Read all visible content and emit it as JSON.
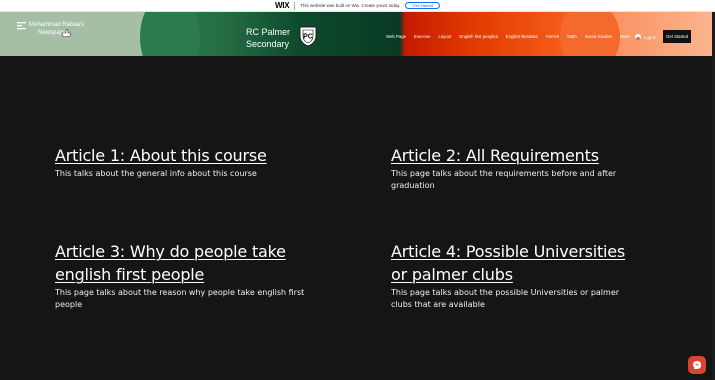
{
  "wix_banner": {
    "logo": "WIX",
    "message": "This website was built on Wix. Create yours today.",
    "button": "Get Started"
  },
  "header": {
    "brand_line1": "Muhammad Rabaa's",
    "brand_line2": "Newspaper",
    "site_title_line1": "RC Palmer",
    "site_title_line2": "Secondary",
    "nav": [
      "Web Page",
      "Exercise",
      "Layout",
      "English first peoples",
      "English literature",
      "French",
      "Math",
      "Social Studies",
      "More"
    ],
    "login": "Log In",
    "cta": "Get Started",
    "colors": {
      "accent": "#d94430",
      "green": "#0d4a2c"
    }
  },
  "articles": [
    {
      "title": "Article 1: About this course",
      "description": "This talks about the general info about this course"
    },
    {
      "title": "Article 2: All Requirements",
      "description": "This page talks about the requirements before and after graduation"
    },
    {
      "title": "Article 3: Why do people take english first people",
      "description": "This page talks about the reason why people take english first people"
    },
    {
      "title": "Article 4: Possible Universities or palmer clubs",
      "description": "This page talks about the possible Universities or palmer clubs that are available"
    }
  ],
  "icons": {
    "chat": "chat-icon",
    "login": "user-icon"
  }
}
